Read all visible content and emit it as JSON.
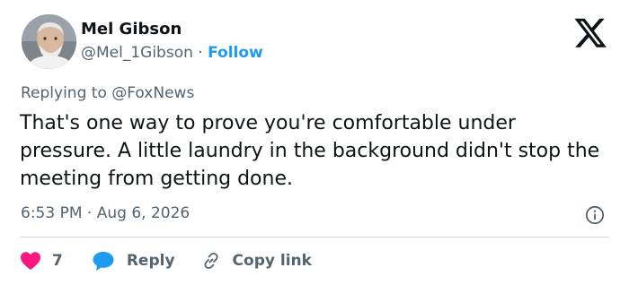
{
  "author": {
    "name": "Mel Gibson",
    "handle": "@Mel_1Gibson",
    "separator": "·",
    "follow_label": "Follow"
  },
  "reply_context": {
    "prefix": "Replying to ",
    "mention": "@FoxNews"
  },
  "body": "That's one way to prove you're comfortable under pressure. A little laundry in the background didn't stop the meeting from getting done.",
  "meta": {
    "time": "6:53 PM",
    "separator": "·",
    "date": "Aug 6, 2026"
  },
  "actions": {
    "like_count": "7",
    "reply_label": "Reply",
    "copy_link_label": "Copy link"
  },
  "icons": {
    "logo": "x-logo-icon",
    "info": "info-icon",
    "like": "heart-icon",
    "reply": "speech-bubble-icon",
    "copy_link": "link-icon"
  },
  "colors": {
    "text": "#0f1419",
    "muted": "#536471",
    "accent": "#1d9bf0",
    "like": "#f91880",
    "divider": "#cfd9de"
  }
}
